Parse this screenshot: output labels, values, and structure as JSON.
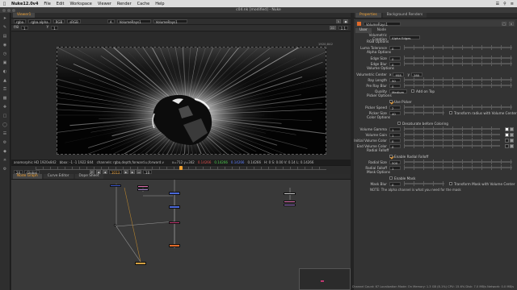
{
  "menubar": {
    "app": "Nuke12.0v4",
    "items": [
      "File",
      "Edit",
      "Workspace",
      "Viewer",
      "Render",
      "Cache",
      "Help"
    ]
  },
  "window": {
    "title": "c04.nk [modified] - Nuke"
  },
  "toolbar": {
    "icons": [
      "pointer-icon",
      "paint-icon",
      "layers-icon",
      "color-icon",
      "time-icon",
      "channel-icon",
      "color-correct-icon",
      "filter-icon",
      "keyer-icon",
      "merge-icon",
      "transform-icon",
      "3d-icon",
      "views-icon",
      "metadata-icon",
      "toolsets-icon",
      "other-icon",
      "cara-icon",
      "settings-icon"
    ]
  },
  "viewer": {
    "tab": "Viewer1",
    "controls": {
      "layer": "rgba",
      "channel": "rgba.alpha",
      "colorspace": "RGB",
      "lut": "sRGB",
      "input_a": "A",
      "node_a": "VolumeRays1",
      "node_b": "VolumeRays1",
      "gain": "f/8",
      "gain_value": "1",
      "gamma_label": "Y",
      "gamma_value": "1",
      "frame_btn": "2D",
      "resolution_label": "1:1"
    },
    "canvas": {
      "corner_label": "1920,842"
    },
    "infobar": {
      "format": "anamorphic HD 1920x842",
      "bbox": "bbox: -1 -1 1922 844",
      "channels": "channels: rgba,depth,forward.u,forward.v",
      "coords": "x=712 y=342",
      "r": "0.14266",
      "g": "0.14266",
      "b": "0.14266",
      "a": "0.14266",
      "hsvl": "H: 0 S: 0.00 V: 0.14  L: 0.14266"
    },
    "timeline": {
      "fps": "24",
      "mode": "Global",
      "frame": "1013",
      "step": "10",
      "start": "1001",
      "end": "1100"
    }
  },
  "nodegraph": {
    "tabs": [
      "Node Graph",
      "Curve Editor",
      "Dope Sheet"
    ],
    "status": "Channel Count: 67 Localization Mode: On Memory: 1.3 GB (8.1%) CPU: 15.6% Disk: 7.0 MB/s Network: 0.0 MB/s"
  },
  "properties": {
    "tabs": [
      "Properties",
      "Background Renders"
    ],
    "node_name": "VolumeRays1",
    "subtabs": [
      "User",
      "Node"
    ],
    "volumetric_creation_label": "Volumetric Creation",
    "volumetric_creation_value": "Alpha Edges",
    "sections": {
      "rgb_options": "RGB Options",
      "alpha_options": "Alpha Options",
      "volume_options": "Volume Options",
      "picker_options": "Picker Options",
      "color_options": "Color Options",
      "radial_falloff": "Radial Falloff",
      "mask_options": "Mask Options"
    },
    "rows": {
      "luma_tolerance": {
        "label": "Luma Tolerance",
        "value": "0"
      },
      "edge_size": {
        "label": "Edge Size",
        "value": "0"
      },
      "edge_blur": {
        "label": "Edge Blur",
        "value": "0"
      },
      "volumetric_center": {
        "label": "Volumetric Center",
        "x_label": "x",
        "x": "958",
        "y_label": "y",
        "y": "280"
      },
      "ray_length": {
        "label": "Ray Length",
        "value": "50"
      },
      "pre_ray_blur": {
        "label": "Pre Ray Blur",
        "value": "0"
      },
      "quality": {
        "label": "Quality",
        "value": "Medium",
        "extra": "Add on Top"
      },
      "use_picker": {
        "label": "Use Picker"
      },
      "picker_speed": {
        "label": "Picker Speed",
        "value": "2"
      },
      "picker_size": {
        "label": "Picker Size",
        "value": "40",
        "extra": "Transform radius with Volume Center"
      },
      "desaturate": {
        "label": "Desaturate before Coloring"
      },
      "volume_gamma": {
        "label": "Volume Gamma",
        "value": "1"
      },
      "volume_gain": {
        "label": "Volume Gain",
        "value": "1"
      },
      "initial_volume_color": {
        "label": "Initial Volume Color",
        "value": "0"
      },
      "end_volume_color": {
        "label": "End Volume Color",
        "value": "0"
      },
      "enable_radial": {
        "label": "Enable Radial Falloff"
      },
      "radial_size": {
        "label": "Radial Size",
        "value": "500"
      },
      "radial_falloff": {
        "label": "Radial Falloff",
        "value": "1"
      },
      "enable_mask": {
        "label": "Enable Mask"
      },
      "mask_blur": {
        "label": "Mask Blur",
        "value": "0",
        "extra": "Transform Mask with Volume Center"
      }
    },
    "note": "NOTE: The alpha channel is what you need for the mask"
  },
  "colors": {
    "accent": "#f0a030",
    "panel": "#333333"
  }
}
